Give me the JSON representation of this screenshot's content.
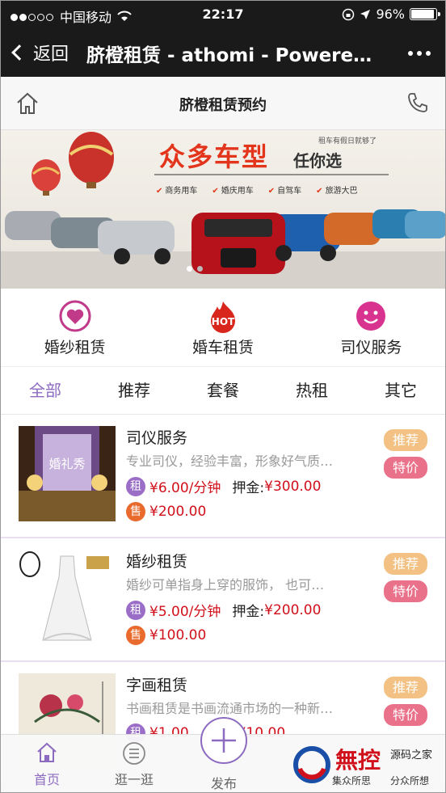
{
  "status_bar": {
    "carrier": "中国移动",
    "time": "22:17",
    "battery": "96%"
  },
  "navbar": {
    "back_label": "返回",
    "title": "脐橙租赁 - athomi - Powere…"
  },
  "page_header": {
    "title": "脐橙租赁预约"
  },
  "banner": {
    "headline": "众多车型",
    "subline": "任你选",
    "tagline": "租车有假日就够了",
    "tags": [
      "商务用车",
      "婚庆用车",
      "自驾车",
      "旅游大巴"
    ]
  },
  "categories": [
    {
      "label": "婚纱租赁",
      "icon": "hearts-icon"
    },
    {
      "label": "婚车租赁",
      "icon": "hot-flame-icon",
      "icon_text": "HOT"
    },
    {
      "label": "司仪服务",
      "icon": "smiley-icon"
    }
  ],
  "tabs": [
    "全部",
    "推荐",
    "套餐",
    "热租",
    "其它"
  ],
  "items": [
    {
      "name": "司仪服务",
      "desc": "专业司仪，经验丰富，形象好气质…",
      "rent_badge": "租",
      "rent_price": "¥6.00/分钟",
      "deposit_label": "押金:",
      "deposit": "¥300.00",
      "sell_badge": "售",
      "sell_price": "¥200.00",
      "tag_recommend": "推荐",
      "tag_special": "特价",
      "thumb_text": "婚礼秀"
    },
    {
      "name": "婚纱租赁",
      "desc": "婚纱可单指身上穿的服饰， 也可…",
      "rent_badge": "租",
      "rent_price": "¥5.00/分钟",
      "deposit_label": "押金:",
      "deposit": "¥200.00",
      "sell_badge": "售",
      "sell_price": "¥100.00",
      "tag_recommend": "推荐",
      "tag_special": "特价"
    },
    {
      "name": "字画租赁",
      "desc": "书画租赁是书画流通市场的一种新…",
      "rent_badge": "租",
      "rent_price": "¥1.00",
      "deposit": "¥10.00",
      "tag_recommend": "推荐",
      "tag_special": "特价"
    }
  ],
  "tabbar": {
    "home": "首页",
    "browse": "逛一逛",
    "publish": "发布"
  },
  "watermark": {
    "brand": "無控",
    "site": "源码之家",
    "slogan1": "集众所思",
    "slogan2": "分众所想"
  },
  "colors": {
    "accent": "#8d6bc0",
    "price": "#d0101a",
    "recommend": "#f2c183",
    "special": "#e9718a"
  }
}
